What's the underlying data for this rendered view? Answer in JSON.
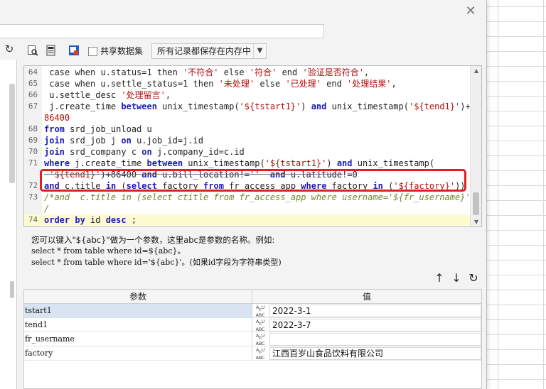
{
  "toolbar": {
    "share_label": "共享数据集",
    "cache_mode": "所有记录都保存在内存中",
    "icons": [
      "refresh-icon",
      "preview-icon",
      "pdf-icon",
      "param-icon"
    ]
  },
  "editor": {
    "lines": [
      {
        "n": "64",
        "tokens": [
          [
            "pl",
            " case "
          ],
          [
            "pl",
            "when u.status=1 then "
          ],
          [
            "str",
            "'不符合'"
          ],
          [
            "pl",
            " else "
          ],
          [
            "str",
            "'符合'"
          ],
          [
            "pl",
            " end "
          ],
          [
            "str",
            "'验证是否符合'"
          ],
          [
            "pl",
            ","
          ]
        ]
      },
      {
        "n": "65",
        "tokens": [
          [
            "pl",
            " case when u.settle_status=1 then "
          ],
          [
            "str",
            "'未处理'"
          ],
          [
            "pl",
            " else "
          ],
          [
            "str",
            "'已处理'"
          ],
          [
            "pl",
            " end "
          ],
          [
            "str",
            "'处理结果'"
          ],
          [
            "pl",
            ","
          ]
        ]
      },
      {
        "n": "66",
        "tokens": [
          [
            "pl",
            " u.settle_desc "
          ],
          [
            "str",
            "'处理留言'"
          ],
          [
            "pl",
            ","
          ]
        ]
      },
      {
        "n": "67",
        "tokens": [
          [
            "pl",
            " j.create_time "
          ],
          [
            "kw",
            "between"
          ],
          [
            "pl",
            " unix_timestamp("
          ],
          [
            "str",
            "'${tstart1}'"
          ],
          [
            "pl",
            ") "
          ],
          [
            "kw",
            "and"
          ],
          [
            "pl",
            " unix_timestamp("
          ],
          [
            "str",
            "'${tend1}'"
          ],
          [
            "pl",
            ")+"
          ]
        ]
      },
      {
        "n": "",
        "tokens": [
          [
            "str",
            "86400"
          ]
        ]
      },
      {
        "n": "68",
        "tokens": [
          [
            "kw",
            "from"
          ],
          [
            "pl",
            " srd_job_unload u"
          ]
        ]
      },
      {
        "n": "69",
        "tokens": [
          [
            "kw",
            "join"
          ],
          [
            "pl",
            " srd_job j "
          ],
          [
            "kw",
            "on"
          ],
          [
            "pl",
            " u.job_id=j.id"
          ]
        ]
      },
      {
        "n": "70",
        "tokens": [
          [
            "kw",
            "join"
          ],
          [
            "pl",
            " srd_company c "
          ],
          [
            "kw",
            "on"
          ],
          [
            "pl",
            " j.company_id=c.id"
          ]
        ]
      },
      {
        "n": "71",
        "tokens": [
          [
            "kw",
            "where"
          ],
          [
            "pl",
            " j.create_time "
          ],
          [
            "kw",
            "between"
          ],
          [
            "pl",
            " unix_timestamp("
          ],
          [
            "str",
            "'${tstart1}'"
          ],
          [
            "pl",
            ") "
          ],
          [
            "kw",
            "and"
          ],
          [
            "pl",
            " unix_timestamp("
          ]
        ]
      },
      {
        "n": "",
        "struck": true,
        "tokens": [
          [
            "str",
            " '${tend1}'"
          ],
          [
            "pl",
            ")+86400 "
          ],
          [
            "kw",
            "and"
          ],
          [
            "pl",
            " u.bill_location!=''  "
          ],
          [
            "kw",
            "and"
          ],
          [
            "pl",
            " u.latitude!=0"
          ]
        ]
      },
      {
        "n": "72",
        "tokens": [
          [
            "kw",
            "and"
          ],
          [
            "pl",
            " c.title "
          ],
          [
            "kw",
            "in"
          ],
          [
            "pl",
            " ("
          ],
          [
            "kw",
            "select"
          ],
          [
            "pl",
            " factory "
          ],
          [
            "kw",
            "from"
          ],
          [
            "pl",
            " fr_access_app "
          ],
          [
            "kw",
            "where"
          ],
          [
            "pl",
            " factory "
          ],
          [
            "kw",
            "in"
          ],
          [
            "pl",
            " ("
          ],
          [
            "str",
            "'${factory}'"
          ],
          [
            "pl",
            "))"
          ]
        ]
      },
      {
        "n": "73",
        "tokens": [
          [
            "cmt",
            "/*and  c.title in (select ctitle from fr_access_app where username='${fr_username}')*"
          ]
        ]
      },
      {
        "n": "",
        "tokens": [
          [
            "cmt",
            "/"
          ]
        ]
      },
      {
        "n": "74",
        "current": true,
        "tokens": [
          [
            "kw",
            "order by"
          ],
          [
            "pl",
            " id "
          ],
          [
            "kw",
            "desc"
          ],
          [
            "pl",
            " ;"
          ]
        ]
      }
    ]
  },
  "hint": {
    "line1": "您可以键入\"${abc}\"做为一个参数，这里abc是参数的名称。例如:",
    "line2": "select * from table where id=${abc}。",
    "line3": "select * from table where id='${abc}'。(如果id字段为字符串类型)"
  },
  "params": {
    "col_name": "参数",
    "col_value": "值",
    "type_label": "A̲b̲c",
    "rows": [
      {
        "name": "tstart1",
        "value": "2022-3-1",
        "selected": true
      },
      {
        "name": "tend1",
        "value": "2022-3-7",
        "selected": false
      },
      {
        "name": "fr_username",
        "value": "",
        "selected": false
      },
      {
        "name": "factory",
        "value": "江西百岁山食品饮料有限公司",
        "selected": false
      }
    ]
  }
}
